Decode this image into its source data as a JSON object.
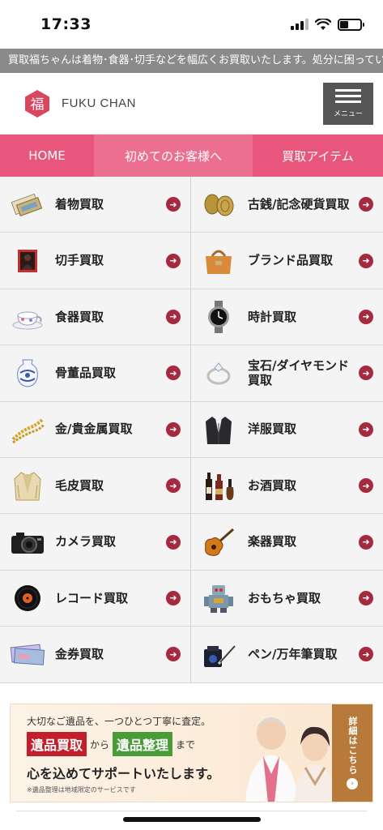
{
  "status": {
    "time": "17:33"
  },
  "ticker": {
    "text": "買取福ちゃんは着物･食器･切手などを幅広くお買取いたします。処分に困ってい"
  },
  "header": {
    "logo_text": "FUKU CHAN",
    "logo_glyph": "福",
    "menu_label": "メニュー"
  },
  "nav": {
    "home": "HOME",
    "first_time": "初めてのお客様へ",
    "items": "買取アイテム"
  },
  "categories": [
    {
      "label": "着物買取",
      "icon": "kimono-icon"
    },
    {
      "label": "古銭/記念硬貨買取",
      "icon": "coin-icon"
    },
    {
      "label": "切手買取",
      "icon": "stamp-icon"
    },
    {
      "label": "ブランド品買取",
      "icon": "handbag-icon"
    },
    {
      "label": "食器買取",
      "icon": "tableware-icon"
    },
    {
      "label": "時計買取",
      "icon": "watch-icon"
    },
    {
      "label": "骨董品買取",
      "icon": "vase-icon"
    },
    {
      "label": "宝石/ダイヤモンド買取",
      "icon": "ring-icon"
    },
    {
      "label": "金/貴金属買取",
      "icon": "gold-chain-icon"
    },
    {
      "label": "洋服買取",
      "icon": "jacket-icon"
    },
    {
      "label": "毛皮買取",
      "icon": "fur-coat-icon"
    },
    {
      "label": "お酒買取",
      "icon": "liquor-icon"
    },
    {
      "label": "カメラ買取",
      "icon": "camera-icon"
    },
    {
      "label": "楽器買取",
      "icon": "guitar-icon"
    },
    {
      "label": "レコード買取",
      "icon": "record-icon"
    },
    {
      "label": "おもちゃ買取",
      "icon": "toy-robot-icon"
    },
    {
      "label": "金券買取",
      "icon": "voucher-icon"
    },
    {
      "label": "ペン/万年筆買取",
      "icon": "pen-icon"
    }
  ],
  "banner": {
    "line1": "大切なご遺品を、一つひとつ丁寧に査定。",
    "tag1": "遺品買取",
    "from": "から",
    "tag2": "遺品整理",
    "made": "まで",
    "line3": "心を込めてサポートいたします。",
    "note": "※遺品整理は地域限定のサービスです",
    "detail": "詳細はこちら"
  },
  "colors": {
    "nav_pink": "#e8567c",
    "arrow": "#a52a3f",
    "menu_bg": "#555555",
    "ticker_bg": "#8a8a8a"
  }
}
